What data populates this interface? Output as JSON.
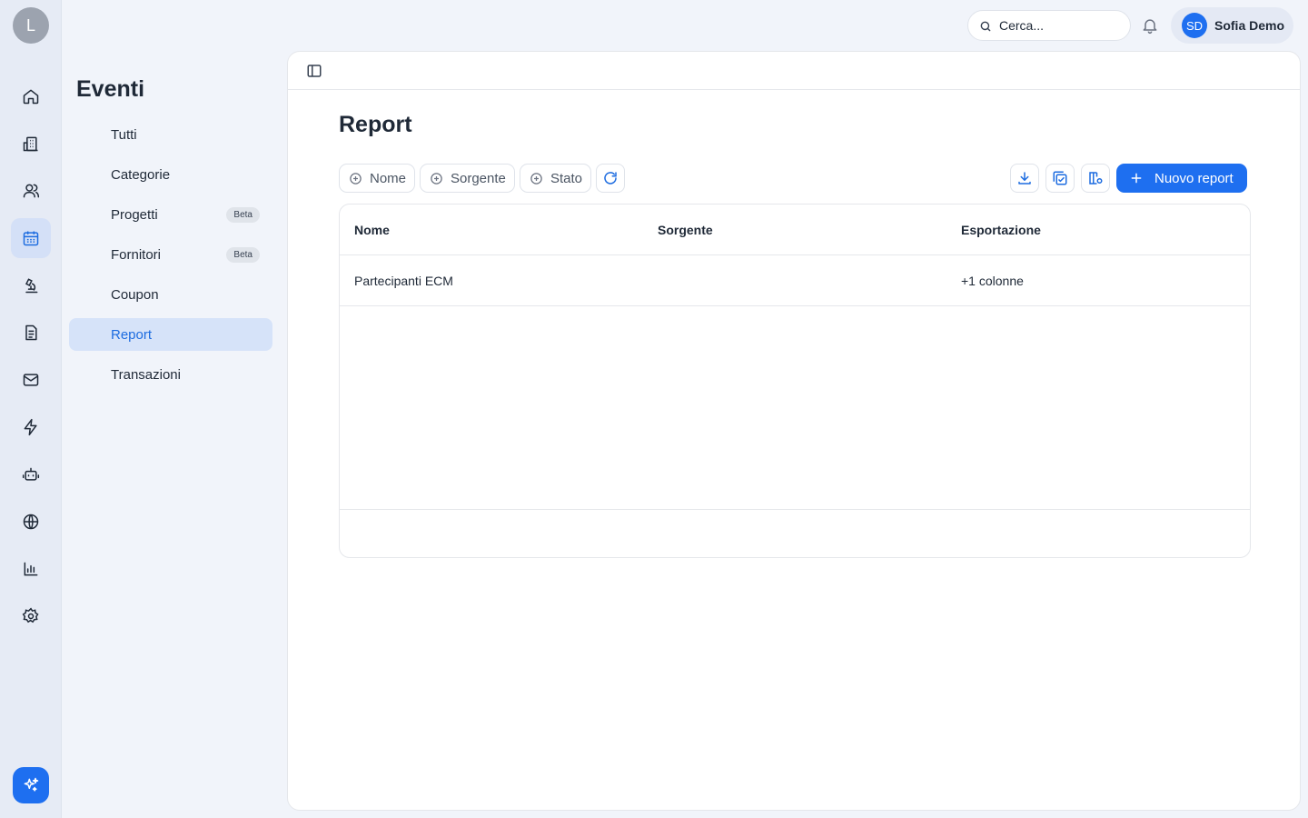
{
  "rail": {
    "avatar_letter": "L",
    "items": [
      {
        "icon": "home-icon",
        "name": "rail-home"
      },
      {
        "icon": "building-icon",
        "name": "rail-organizations"
      },
      {
        "icon": "users-icon",
        "name": "rail-contacts"
      },
      {
        "icon": "calendar-icon",
        "name": "rail-events",
        "active": true
      },
      {
        "icon": "microscope-icon",
        "name": "rail-research"
      },
      {
        "icon": "document-icon",
        "name": "rail-documents"
      },
      {
        "icon": "mail-icon",
        "name": "rail-mail"
      },
      {
        "icon": "lightning-icon",
        "name": "rail-automations"
      },
      {
        "icon": "robot-icon",
        "name": "rail-bots"
      },
      {
        "icon": "globe-icon",
        "name": "rail-web"
      },
      {
        "icon": "bar-chart-icon",
        "name": "rail-analytics"
      },
      {
        "icon": "gear-icon",
        "name": "rail-settings"
      }
    ],
    "ai_icon": "sparkles-icon"
  },
  "subnav": {
    "title": "Eventi",
    "items": [
      {
        "label": "Tutti"
      },
      {
        "label": "Categorie"
      },
      {
        "label": "Progetti",
        "badge": "Beta"
      },
      {
        "label": "Fornitori",
        "badge": "Beta"
      },
      {
        "label": "Coupon"
      },
      {
        "label": "Report",
        "active": true
      },
      {
        "label": "Transazioni"
      }
    ]
  },
  "header": {
    "search_placeholder": "Cerca...",
    "user_initials": "SD",
    "user_name": "Sofia Demo"
  },
  "main": {
    "title": "Report",
    "filters": [
      "Nome",
      "Sorgente",
      "Stato"
    ],
    "new_button": "Nuovo report",
    "table": {
      "columns": [
        "Nome",
        "Sorgente",
        "Esportazione"
      ],
      "rows": [
        {
          "nome": "Partecipanti ECM",
          "sorgente": "",
          "esportazione": "+1 colonne"
        }
      ]
    }
  },
  "colors": {
    "accent": "#1e6ff0",
    "active_bg": "#d6e3f9",
    "background": "#f1f4fa"
  }
}
